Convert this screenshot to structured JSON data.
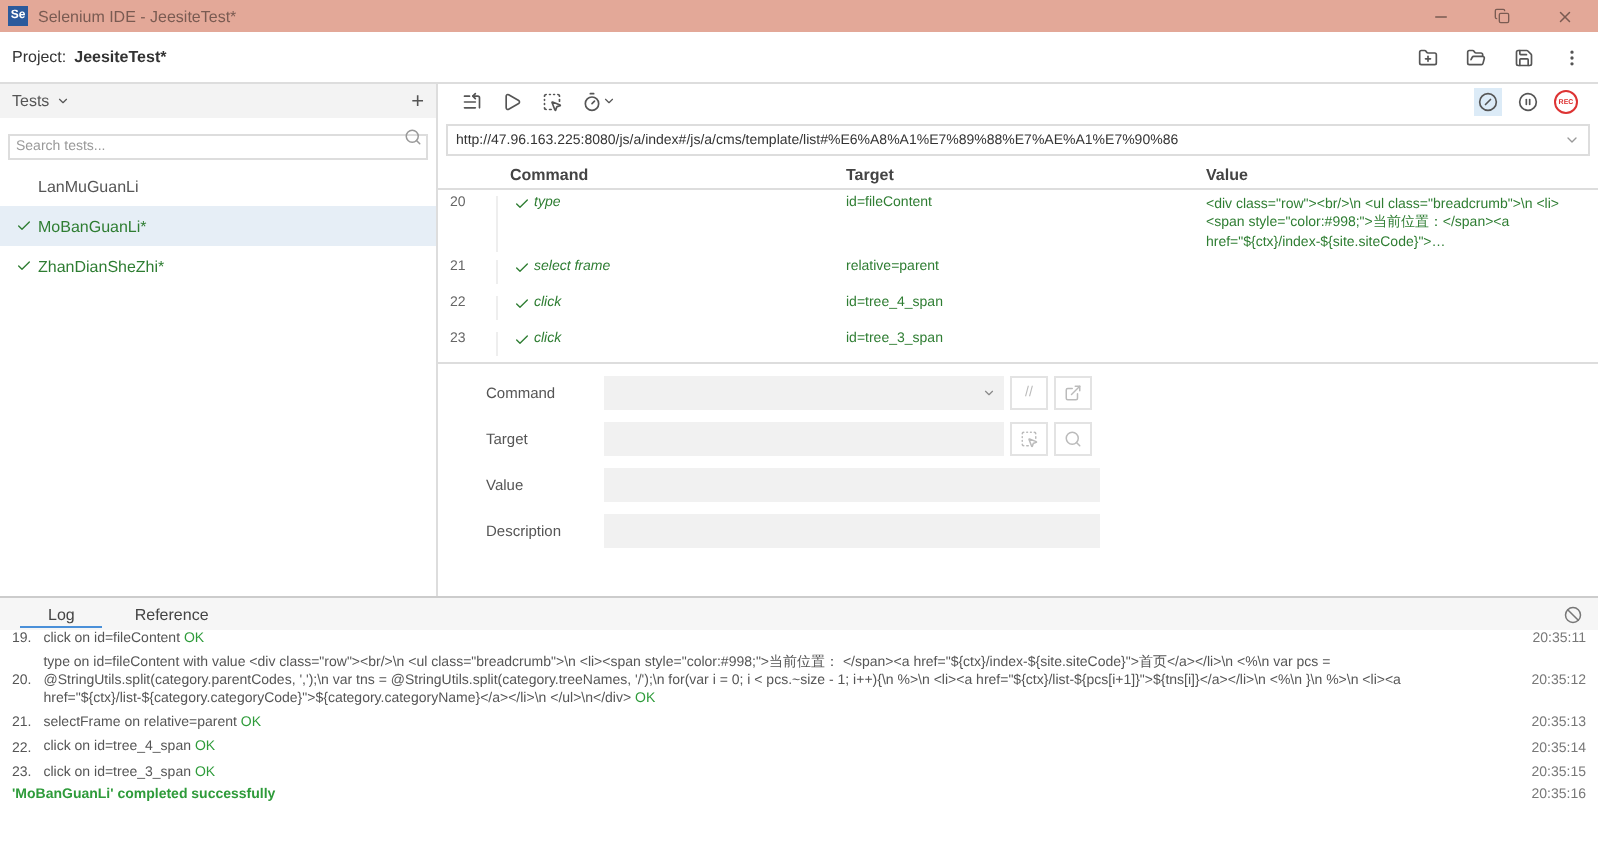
{
  "window": {
    "logo": "Se",
    "title": "Selenium IDE - JeesiteTest*"
  },
  "project": {
    "label": "Project:",
    "name": "JeesiteTest*"
  },
  "tests": {
    "title": "Tests",
    "add": "+",
    "search": {
      "placeholder": "Search tests..."
    },
    "items": [
      {
        "name": "LanMuGuanLi",
        "passed": false,
        "selected": false
      },
      {
        "name": "MoBanGuanLi*",
        "passed": true,
        "selected": true
      },
      {
        "name": "ZhanDianSheZhi*",
        "passed": true,
        "selected": false
      }
    ]
  },
  "toolbar": {
    "breakpoints_disabled": true,
    "record": "REC"
  },
  "url": "http://47.96.163.225:8080/js/a/index#/js/a/cms/template/list#%E6%A8%A1%E7%89%88%E7%AE%A1%E7%90%86",
  "table": {
    "columns": [
      "Command",
      "Target",
      "Value"
    ],
    "rows": [
      {
        "number": "20",
        "command": "type",
        "target": "id=fileContent",
        "value": "<div class=\"row\"><br/>\\n <ul class=\"breadcrumb\">\\n <li><span style=\"color:#998;\">当前位置：</span><a href=\"${ctx}/index-${site.siteCode}\">…",
        "passed": true
      },
      {
        "number": "21",
        "command": "select frame",
        "target": "relative=parent",
        "passed": true
      },
      {
        "number": "22",
        "command": "click",
        "target": "id=tree_4_span",
        "passed": true
      },
      {
        "number": "23",
        "command": "click",
        "target": "id=tree_3_span",
        "passed": true
      }
    ]
  },
  "editor": {
    "fields": [
      {
        "label": "Command",
        "kind": "command"
      },
      {
        "label": "Target",
        "kind": "target"
      },
      {
        "label": "Value",
        "kind": "plain"
      },
      {
        "label": "Description",
        "kind": "plain"
      }
    ],
    "comment": "//"
  },
  "log": {
    "tabs": [
      {
        "label": "Log",
        "selected": true
      },
      {
        "label": "Reference",
        "selected": false
      }
    ],
    "entries": [
      {
        "number": "19.",
        "text": "click on id=fileContent",
        "status": "OK",
        "time": "20:35:11"
      },
      {
        "number": "20.",
        "text": "type on id=fileContent with value <div class=\"row\"><br/>\\n <ul class=\"breadcrumb\">\\n <li><span style=\"color:#998;\">当前位置： </span><a href=\"${ctx}/index-${site.siteCode}\">首页</a></li>\\n <%\\n var pcs = @StringUtils.split(category.parentCodes, ',');\\n var tns = @StringUtils.split(category.treeNames, '/');\\n for(var i = 0; i < pcs.~size - 1; i++){\\n %>\\n <li><a href=\"${ctx}/list-${pcs[i+1]}\">${tns[i]}</a></li>\\n <%\\n }\\n %>\\n <li><a href=\"${ctx}/list-${category.categoryCode}\">${category.categoryName}</a></li>\\n </ul>\\n</div>",
        "status": "OK",
        "time": "20:35:12"
      },
      {
        "number": "21.",
        "text": "selectFrame on relative=parent",
        "status": "OK",
        "time": "20:35:13"
      },
      {
        "number": "22.",
        "text": "click on id=tree_4_span",
        "status": "OK",
        "time": "20:35:14"
      },
      {
        "number": "23.",
        "text": "click on id=tree_3_span",
        "status": "OK",
        "time": "20:35:15"
      }
    ],
    "summary": {
      "text": "'MoBanGuanLi' completed successfully",
      "time": "20:35:16"
    }
  }
}
